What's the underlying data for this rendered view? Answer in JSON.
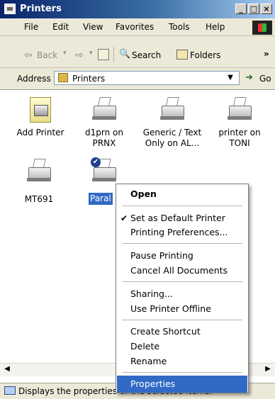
{
  "window": {
    "title": "Printers"
  },
  "menubar": {
    "items": [
      "File",
      "Edit",
      "View",
      "Favorites",
      "Tools",
      "Help"
    ]
  },
  "toolbar": {
    "back": "Back",
    "search": "Search",
    "folders": "Folders",
    "more": "»"
  },
  "addressbar": {
    "label": "Address",
    "value": "Printers",
    "go": "Go"
  },
  "printers": [
    {
      "label": "Add Printer"
    },
    {
      "label": "d1prn on PRNX"
    },
    {
      "label": "Generic / Text Only on AL..."
    },
    {
      "label": "printer on TONI"
    },
    {
      "label": "MT691"
    },
    {
      "label": "Paral"
    }
  ],
  "context_menu": {
    "open": "Open",
    "set_default": "Set as Default Printer",
    "preferences": "Printing Preferences...",
    "pause": "Pause Printing",
    "cancel_all": "Cancel All Documents",
    "sharing": "Sharing...",
    "offline": "Use Printer Offline",
    "shortcut": "Create Shortcut",
    "delete": "Delete",
    "rename": "Rename",
    "properties": "Properties"
  },
  "statusbar": {
    "text": "Displays the properties of the selected items."
  },
  "colors": {
    "highlight": "#316ac5",
    "titlebar": "#0a246a",
    "chrome": "#ece9d8"
  }
}
